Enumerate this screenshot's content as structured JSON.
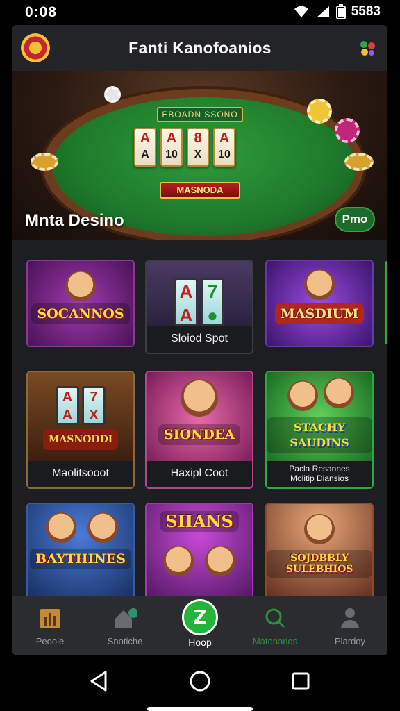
{
  "status_bar": {
    "time": "0:08",
    "battery_text": "5583"
  },
  "header": {
    "title": "Fanti Kanofoanios"
  },
  "hero": {
    "table_sign": "EBOADN SSONO",
    "cards": [
      {
        "top": "A",
        "bottom": "A"
      },
      {
        "top": "A",
        "bottom": "10"
      },
      {
        "top": "8",
        "bottom": "X"
      },
      {
        "top": "A",
        "bottom": "10"
      }
    ],
    "table_banner": "MASNODA",
    "title": "Mnta Desino",
    "play_button": "Pmo"
  },
  "games": [
    {
      "logo": "SOCANNOS",
      "label": "",
      "theme": "purple"
    },
    {
      "logo": "",
      "label": "Sloiod Spot",
      "theme": "reels",
      "reels": [
        "A",
        "7",
        "A",
        "●"
      ]
    },
    {
      "logo": "MASDIUM",
      "label": "",
      "theme": "purple2"
    },
    {
      "logo": "MASNODDI",
      "label": "Maolitsooot",
      "theme": "reels2",
      "reels": [
        "A",
        "7",
        "A",
        "X"
      ]
    },
    {
      "logo": "SIONDEA",
      "label": "Haxipl Coot",
      "theme": "pink"
    },
    {
      "logo": "STACHY SAUDINS",
      "label_line1": "Pacla Resannes",
      "label_line2": "Molitip Diansios",
      "theme": "green"
    },
    {
      "logo": "BAYTHINES",
      "label": "",
      "theme": "blue"
    },
    {
      "logo": "SIIANS",
      "label": "",
      "theme": "magenta"
    },
    {
      "logo": "SOJDBBLY SULEBHIOS",
      "label": "",
      "theme": "stage"
    }
  ],
  "bottom_nav": [
    {
      "label": "Peoole"
    },
    {
      "label": "Snotiche"
    },
    {
      "label": "Hoop",
      "icon_letter": "Z"
    },
    {
      "label": "Matonarios"
    },
    {
      "label": "Plardoy"
    }
  ],
  "colors": {
    "accent_green": "#23b53a",
    "felt_green": "#1e7a2b",
    "gold": "#ffd84a",
    "panel": "#1d1e22"
  }
}
